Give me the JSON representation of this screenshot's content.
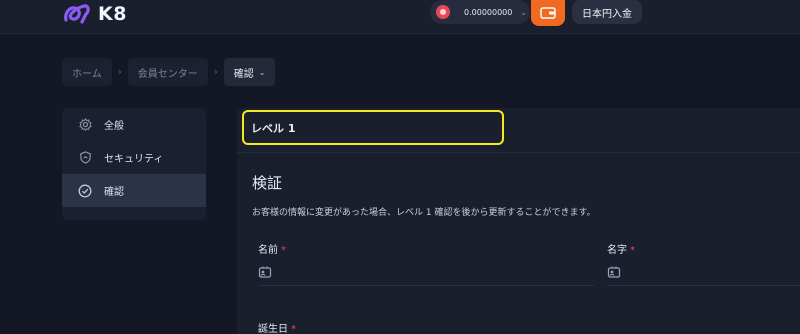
{
  "header": {
    "logo_text": "K8",
    "balance_value": "0.00000000",
    "deposit_label": "日本円入金",
    "colors": {
      "accent": "#f26a22",
      "coin": "#e84855"
    }
  },
  "breadcrumb": {
    "items": [
      "ホーム",
      "会員センター"
    ],
    "current": "確認"
  },
  "sidebar": {
    "items": [
      {
        "label": "全般",
        "icon": "gear-icon"
      },
      {
        "label": "セキュリティ",
        "icon": "shield-icon"
      },
      {
        "label": "確認",
        "icon": "check-circle-icon",
        "active": true
      }
    ]
  },
  "main": {
    "level_tab": "レベル 1",
    "title": "検証",
    "description": "お客様の情報に変更があった場合、レベル 1 確認を後から更新することができます。",
    "fields": [
      {
        "label": "名前",
        "required": "*"
      },
      {
        "label": "名字",
        "required": "*"
      },
      {
        "label": "誕生日",
        "required": "*"
      }
    ]
  }
}
